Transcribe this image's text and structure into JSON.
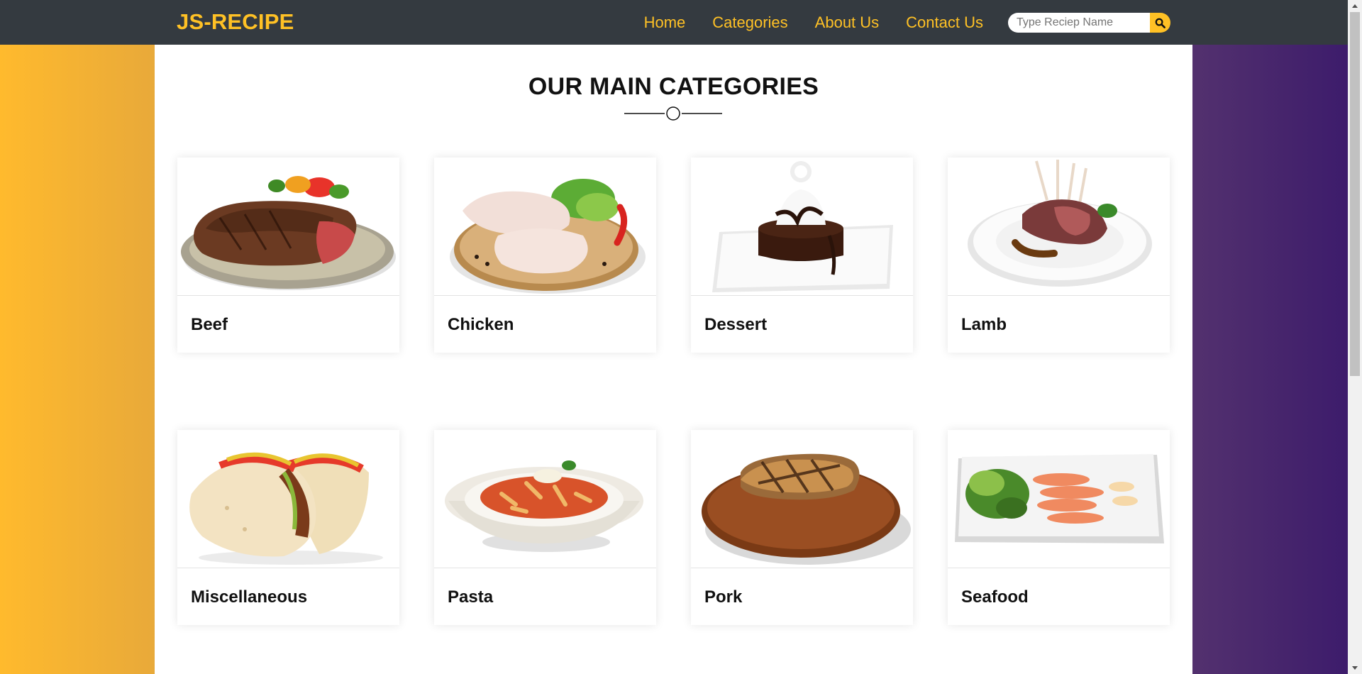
{
  "navbar": {
    "brand": "JS-RECIPE",
    "links": [
      "Home",
      "Categories",
      "About Us",
      "Contact Us"
    ],
    "search": {
      "placeholder": "Type Reciep Name",
      "value": ""
    }
  },
  "main": {
    "title": "OUR MAIN CATEGORIES",
    "categories": [
      {
        "name": "Beef",
        "icon": "steak-plate-image"
      },
      {
        "name": "Chicken",
        "icon": "chicken-legs-image"
      },
      {
        "name": "Dessert",
        "icon": "chocolate-cake-image"
      },
      {
        "name": "Lamb",
        "icon": "lamb-chops-image"
      },
      {
        "name": "Miscellaneous",
        "icon": "tacos-image"
      },
      {
        "name": "Pasta",
        "icon": "pasta-bowl-image"
      },
      {
        "name": "Pork",
        "icon": "pork-chop-image"
      },
      {
        "name": "Seafood",
        "icon": "salmon-plate-image"
      }
    ]
  },
  "colors": {
    "navbar_bg": "#343a40",
    "accent": "#ffc125",
    "left_gradient": "#ffba2d",
    "right_gradient": "#3b1a6b"
  }
}
